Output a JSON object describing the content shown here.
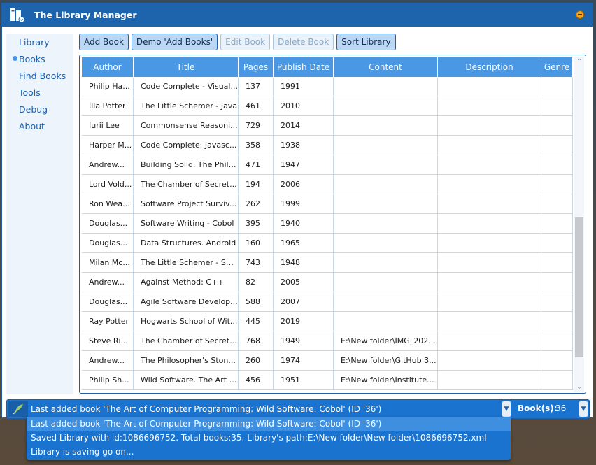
{
  "window": {
    "title": "The Library Manager",
    "accent": "#1e64ad"
  },
  "sidebar": {
    "items": [
      {
        "label": "Library",
        "active": false
      },
      {
        "label": "Books",
        "active": true
      },
      {
        "label": "Find Books",
        "active": false
      },
      {
        "label": "Tools",
        "active": false
      },
      {
        "label": "Debug",
        "active": false
      },
      {
        "label": "About",
        "active": false
      }
    ]
  },
  "toolbar": {
    "add_book": "Add Book",
    "demo_add_books": "Demo 'Add Books'",
    "edit_book": "Edit Book",
    "delete_book": "Delete Book",
    "sort_library": "Sort Library"
  },
  "table": {
    "columns": [
      "Author",
      "Title",
      "Pages",
      "Publish Date",
      "Content",
      "Description",
      "Genre"
    ],
    "rows": [
      [
        "Philip Ha...",
        "Code Complete - Visual...",
        "137",
        "1991",
        "",
        "",
        ""
      ],
      [
        "Illa Potter",
        "The Little Schemer - Java",
        "461",
        "2010",
        "",
        "",
        ""
      ],
      [
        "Iurii Lee",
        "Commonsense Reasoni...",
        "729",
        "2014",
        "",
        "",
        ""
      ],
      [
        "Harper M...",
        "Code Complete: Javasc...",
        "358",
        "1938",
        "",
        "",
        ""
      ],
      [
        "Andrew...",
        "Building Solid. The Philo...",
        "471",
        "1947",
        "",
        "",
        ""
      ],
      [
        "Lord Vold...",
        "The Chamber of Secret...",
        "194",
        "2006",
        "",
        "",
        ""
      ],
      [
        "Ron Wea...",
        "Software Project Surviv...",
        "262",
        "1999",
        "",
        "",
        ""
      ],
      [
        "Douglas...",
        "Software Writing - Cobol",
        "395",
        "1940",
        "",
        "",
        ""
      ],
      [
        "Douglas...",
        "Data Structures. Android",
        "160",
        "1965",
        "",
        "",
        ""
      ],
      [
        "Milan Mc...",
        "The Little Schemer - Sof...",
        "743",
        "1948",
        "",
        "",
        ""
      ],
      [
        "Andrew...",
        "Against Method: C++",
        "82",
        "2005",
        "",
        "",
        ""
      ],
      [
        "Douglas...",
        "Agile Software Develop...",
        "588",
        "2007",
        "",
        "",
        ""
      ],
      [
        "Ray Potter",
        "Hogwarts School of Wit...",
        "445",
        "2019",
        "",
        "",
        ""
      ],
      [
        "Steve Ri...",
        "The Chamber of Secret...",
        "768",
        "1949",
        "E:\\New folder\\IMG_202...",
        "",
        ""
      ],
      [
        "Andrew...",
        "The Philosopher's Ston...",
        "260",
        "1974",
        "E:\\New folder\\GitHub 3...",
        "",
        ""
      ],
      [
        "Philip Sh...",
        "Wild Software. The Art o...",
        "456",
        "1951",
        "E:\\New  folder\\Institute...",
        "",
        ""
      ]
    ]
  },
  "status": {
    "current": "Last added book 'The Art of Computer Programming: Wild Software: Cobol' (ID '36')",
    "books_label": "Book(s):",
    "books_count": "36",
    "log": [
      "Last added book 'The Art of Computer Programming: Wild Software: Cobol' (ID '36')",
      "Saved Library with id:1086696752. Total books:35. Library's path:E:\\New folder\\New folder\\1086696752.xml",
      "Library is saving go on..."
    ]
  }
}
